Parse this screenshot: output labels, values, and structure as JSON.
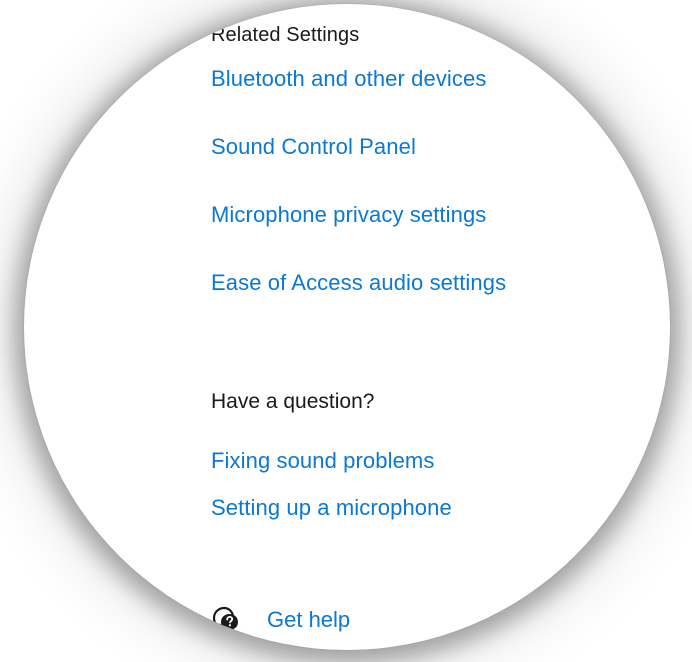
{
  "related_settings": {
    "heading": "Related Settings",
    "links": [
      {
        "label": "Bluetooth and other devices"
      },
      {
        "label": "Sound Control Panel"
      },
      {
        "label": "Microphone privacy settings"
      },
      {
        "label": "Ease of Access audio settings"
      }
    ]
  },
  "help_section": {
    "heading": "Have a question?",
    "links": [
      {
        "label": "Fixing sound problems"
      },
      {
        "label": "Setting up a microphone"
      }
    ]
  },
  "get_help": {
    "label": "Get help",
    "icon": "chat-question-icon"
  },
  "colors": {
    "link": "#0a78d4",
    "text": "#1a1a1a",
    "background": "#ffffff"
  }
}
